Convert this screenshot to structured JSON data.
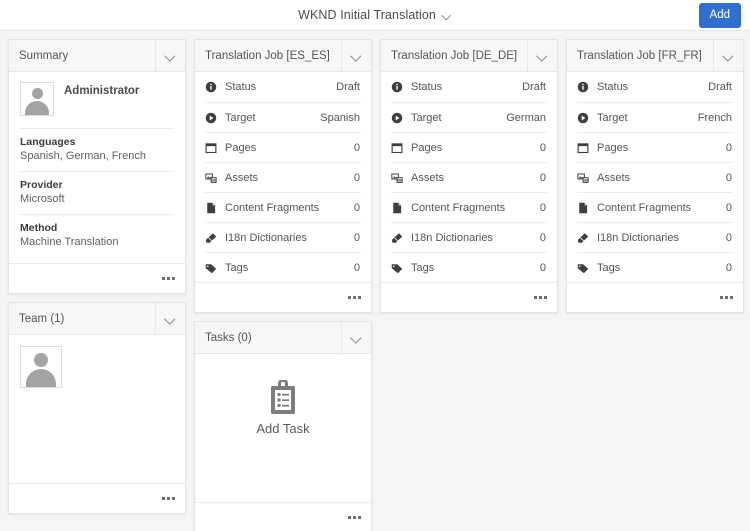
{
  "header": {
    "title": "WKND Initial Translation",
    "title_caret_icon": "chevron-down-icon",
    "add_label": "Add"
  },
  "cards": {
    "summary": {
      "title": "Summary",
      "toggle_icon": "chevron-down-icon",
      "user": "Administrator",
      "avatar_icon": "user-avatar-icon",
      "fields": [
        {
          "label": "Languages",
          "value": "Spanish, German, French"
        },
        {
          "label": "Provider",
          "value": "Microsoft"
        },
        {
          "label": "Method",
          "value": "Machine Translation"
        }
      ],
      "more_icon": "more-options-icon"
    },
    "team": {
      "title": "Team (1)",
      "toggle_icon": "chevron-down-icon",
      "avatar_icon": "user-avatar-icon",
      "more_icon": "more-options-icon"
    },
    "tasks": {
      "title": "Tasks (0)",
      "toggle_icon": "chevron-down-icon",
      "add_task_label": "Add Task",
      "add_task_icon": "clipboard-task-icon",
      "more_icon": "more-options-icon"
    },
    "jobs": [
      {
        "title": "Translation Job [ES_ES]",
        "toggle_icon": "chevron-down-icon",
        "more_icon": "more-options-icon",
        "rows": [
          {
            "icon": "info-circle-icon",
            "label": "Status",
            "value": "Draft"
          },
          {
            "icon": "play-circle-icon",
            "label": "Target",
            "value": "Spanish"
          },
          {
            "icon": "pages-icon",
            "label": "Pages",
            "value": "0"
          },
          {
            "icon": "assets-image-icon",
            "label": "Assets",
            "value": "0"
          },
          {
            "icon": "document-icon",
            "label": "Content Fragments",
            "value": "0"
          },
          {
            "icon": "eraser-icon",
            "label": "I18n Dictionaries",
            "value": "0"
          },
          {
            "icon": "tag-icon",
            "label": "Tags",
            "value": "0"
          }
        ]
      },
      {
        "title": "Translation Job [DE_DE]",
        "toggle_icon": "chevron-down-icon",
        "more_icon": "more-options-icon",
        "rows": [
          {
            "icon": "info-circle-icon",
            "label": "Status",
            "value": "Draft"
          },
          {
            "icon": "play-circle-icon",
            "label": "Target",
            "value": "German"
          },
          {
            "icon": "pages-icon",
            "label": "Pages",
            "value": "0"
          },
          {
            "icon": "assets-image-icon",
            "label": "Assets",
            "value": "0"
          },
          {
            "icon": "document-icon",
            "label": "Content Fragments",
            "value": "0"
          },
          {
            "icon": "eraser-icon",
            "label": "I18n Dictionaries",
            "value": "0"
          },
          {
            "icon": "tag-icon",
            "label": "Tags",
            "value": "0"
          }
        ]
      },
      {
        "title": "Translation Job [FR_FR]",
        "toggle_icon": "chevron-down-icon",
        "more_icon": "more-options-icon",
        "rows": [
          {
            "icon": "info-circle-icon",
            "label": "Status",
            "value": "Draft"
          },
          {
            "icon": "play-circle-icon",
            "label": "Target",
            "value": "French"
          },
          {
            "icon": "pages-icon",
            "label": "Pages",
            "value": "0"
          },
          {
            "icon": "assets-image-icon",
            "label": "Assets",
            "value": "0"
          },
          {
            "icon": "document-icon",
            "label": "Content Fragments",
            "value": "0"
          },
          {
            "icon": "eraser-icon",
            "label": "I18n Dictionaries",
            "value": "0"
          },
          {
            "icon": "tag-icon",
            "label": "Tags",
            "value": "0"
          }
        ]
      }
    ]
  },
  "colors": {
    "accent": "#2f6fd0",
    "page_bg": "#f5f5f5",
    "card_bg": "#ffffff",
    "header_bg": "#f7f7f7",
    "text": "#4b4b4b"
  }
}
